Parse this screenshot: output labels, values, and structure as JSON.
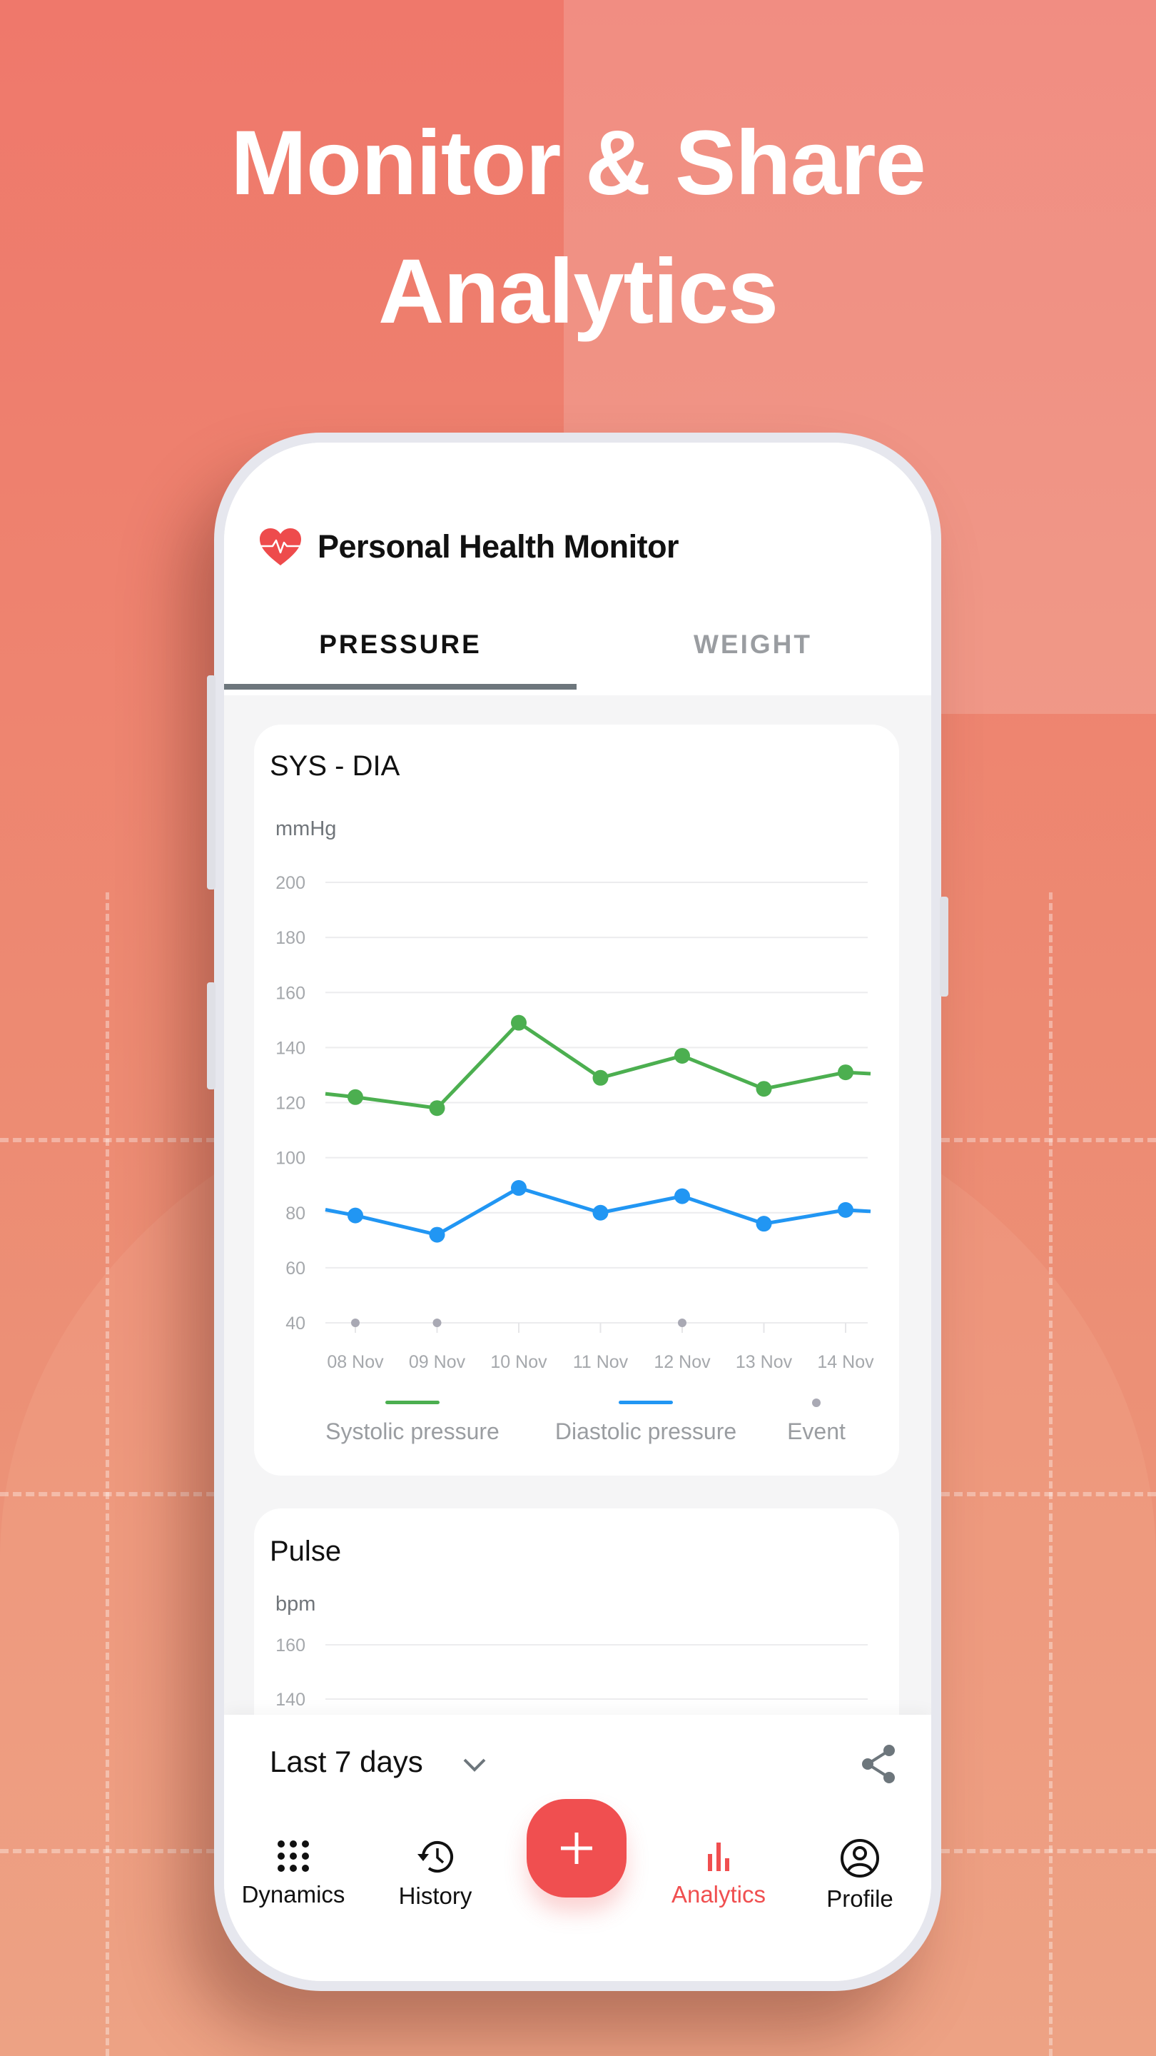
{
  "headline": {
    "line1": "Monitor & Share",
    "line2": "Analytics"
  },
  "app": {
    "title": "Personal Health Monitor",
    "icon": "heart-pulse-icon"
  },
  "tabs": [
    {
      "label": "PRESSURE",
      "active": true
    },
    {
      "label": "WEIGHT",
      "active": false
    }
  ],
  "colors": {
    "accent": "#f04f50",
    "systolic": "#4caf50",
    "diastolic": "#2196f3",
    "event": "#a9a9b4"
  },
  "pressure_card": {
    "title": "SYS - DIA",
    "unit": "mmHg"
  },
  "pulse_card": {
    "title": "Pulse",
    "unit": "bpm",
    "y_ticks": [
      "160",
      "140"
    ]
  },
  "chart_data": {
    "type": "line",
    "title": "SYS - DIA",
    "ylabel": "mmHg",
    "ylim": [
      40,
      200
    ],
    "y_ticks": [
      200,
      180,
      160,
      140,
      120,
      100,
      80,
      60,
      40
    ],
    "categories": [
      "08 Nov",
      "09 Nov",
      "10 Nov",
      "11 Nov",
      "12 Nov",
      "13 Nov",
      "14 Nov"
    ],
    "grid": true,
    "legend_placement": "bottom",
    "series": [
      {
        "name": "Systolic pressure",
        "color": "#4caf50",
        "values": [
          122,
          118,
          149,
          129,
          137,
          125,
          131
        ]
      },
      {
        "name": "Diastolic pressure",
        "color": "#2196f3",
        "values": [
          79,
          72,
          89,
          80,
          86,
          76,
          81
        ]
      },
      {
        "name": "Event",
        "color": "#a9a9b4",
        "type": "scatter",
        "x": [
          "08 Nov",
          "09 Nov",
          "12 Nov"
        ],
        "values": [
          40,
          40,
          40
        ]
      }
    ]
  },
  "footer": {
    "range_label": "Last 7 days",
    "share_icon": "share-icon"
  },
  "nav": [
    {
      "label": "Dynamics",
      "icon": "grid-dots-icon"
    },
    {
      "label": "History",
      "icon": "history-icon"
    },
    {
      "label": "Analytics",
      "icon": "bar-chart-icon",
      "active": true
    },
    {
      "label": "Profile",
      "icon": "profile-icon"
    }
  ],
  "fab": {
    "icon": "plus-icon"
  }
}
